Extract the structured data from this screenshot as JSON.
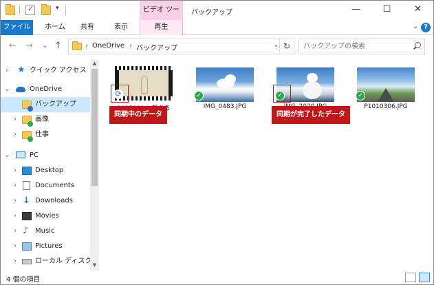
{
  "titlebar": {
    "context_tab": "ビデオ ツール",
    "title": "バックアップ",
    "minimize": "—",
    "maximize": "☐",
    "close": "✕"
  },
  "ribbon": {
    "tabs": [
      "ファイル",
      "ホーム",
      "共有",
      "表示",
      "再生"
    ],
    "toggle": "⌄",
    "help": "?"
  },
  "nav": {
    "back": "←",
    "forward": "→",
    "recent": "⌄",
    "up": "↑"
  },
  "address": {
    "crumbs": [
      "OneDrive",
      "バックアップ"
    ],
    "separator": "›",
    "refresh": "↻"
  },
  "search": {
    "placeholder": "バックアップの検索"
  },
  "sidebar": {
    "items": [
      {
        "label": "クイック アクセス",
        "icon": "star-icon",
        "chevron": "›"
      },
      {
        "label": "OneDrive",
        "icon": "onedrive-cloud-icon",
        "chevron": "⌄"
      },
      {
        "label": "バックアップ",
        "icon": "folder-syncing-icon",
        "chevron": ""
      },
      {
        "label": "画像",
        "icon": "folder-synced-icon",
        "chevron": "›"
      },
      {
        "label": "仕事",
        "icon": "folder-synced-icon",
        "chevron": "›"
      },
      {
        "label": "PC",
        "icon": "pc-icon",
        "chevron": "⌄"
      },
      {
        "label": "Desktop",
        "icon": "desktop-icon",
        "chevron": "›"
      },
      {
        "label": "Documents",
        "icon": "documents-icon",
        "chevron": "›"
      },
      {
        "label": "Downloads",
        "icon": "downloads-icon",
        "chevron": "›"
      },
      {
        "label": "Movies",
        "icon": "movies-icon",
        "chevron": "›"
      },
      {
        "label": "Music",
        "icon": "music-icon",
        "chevron": "›"
      },
      {
        "label": "Pictures",
        "icon": "pictures-icon",
        "chevron": "›"
      },
      {
        "label": "ローカル ディスク (C",
        "icon": "local-disk-icon",
        "chevron": "›"
      }
    ],
    "scroll_up": "▲",
    "scroll_down": "▼"
  },
  "files": [
    {
      "name": "20151224_顔ある",
      "status": "syncing"
    },
    {
      "name": "IMG_0483.JPG",
      "status": "synced"
    },
    {
      "name": "IMG_2020.JPG",
      "status": "synced"
    },
    {
      "name": "P1010306.JPG",
      "status": "synced"
    }
  ],
  "callouts": {
    "syncing": "同期中のデータ",
    "synced": "同期が完了したデータ"
  },
  "status": {
    "count": "4 個の項目"
  },
  "colors": {
    "accent": "#1979ca",
    "context_tab": "#f8d1e8",
    "callout": "#c01818",
    "synced_check": "#2fa84f",
    "selection": "#cce8ff"
  }
}
